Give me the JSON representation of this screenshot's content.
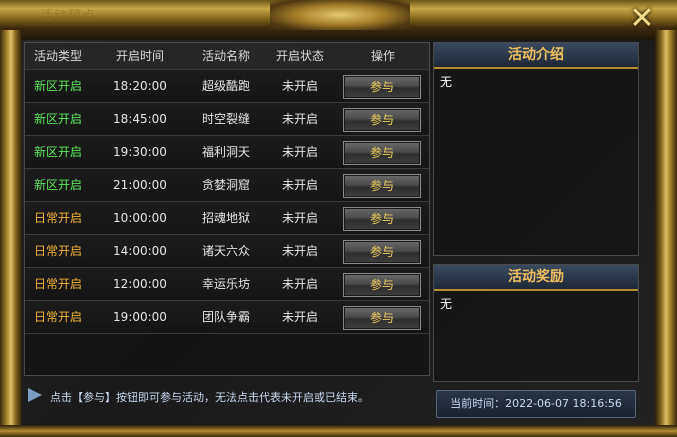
{
  "window": {
    "ghost_title": "活动预点"
  },
  "close_label": "✕",
  "colors": {
    "new_server": "#5ee65e",
    "daily": "#f2b23a",
    "title_gold": "#f0c060",
    "button_text": "#f0d060"
  },
  "table": {
    "headers": [
      "活动类型",
      "开启时间",
      "活动名称",
      "开启状态",
      "操作"
    ],
    "rows": [
      {
        "type": "新区开启",
        "time": "18:20:00",
        "name": "超级酷跑",
        "state": "未开启",
        "action": "参与"
      },
      {
        "type": "新区开启",
        "time": "18:45:00",
        "name": "时空裂缝",
        "state": "未开启",
        "action": "参与"
      },
      {
        "type": "新区开启",
        "time": "19:30:00",
        "name": "福利洞天",
        "state": "未开启",
        "action": "参与"
      },
      {
        "type": "新区开启",
        "time": "21:00:00",
        "name": "贪婪洞窟",
        "state": "未开启",
        "action": "参与"
      },
      {
        "type": "日常开启",
        "time": "10:00:00",
        "name": "招魂地狱",
        "state": "未开启",
        "action": "参与"
      },
      {
        "type": "日常开启",
        "time": "14:00:00",
        "name": "诸天六众",
        "state": "未开启",
        "action": "参与"
      },
      {
        "type": "日常开启",
        "time": "12:00:00",
        "name": "幸运乐坊",
        "state": "未开启",
        "action": "参与"
      },
      {
        "type": "日常开启",
        "time": "19:00:00",
        "name": "团队争霸",
        "state": "未开启",
        "action": "参与"
      }
    ]
  },
  "intro": {
    "title": "活动介绍",
    "content": "无"
  },
  "reward": {
    "title": "活动奖励",
    "content": "无"
  },
  "footer": {
    "hint": "点击【参与】按钮即可参与活动，无法点击代表未开启或已结束。",
    "current_time": "当前时间：2022-06-07  18:16:56"
  }
}
